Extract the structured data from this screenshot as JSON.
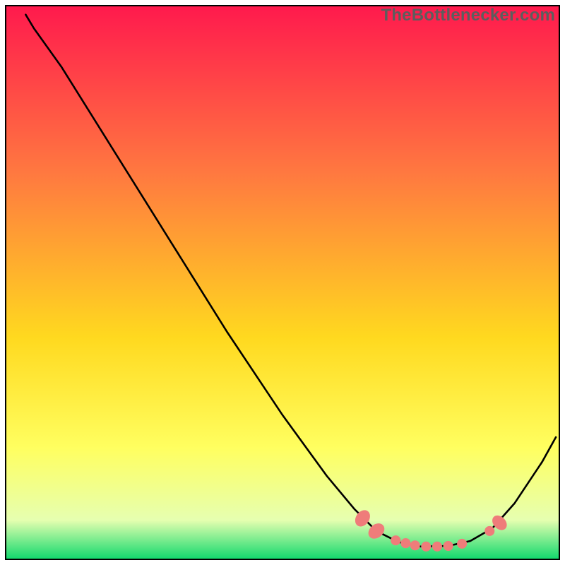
{
  "watermark": "TheBottlenecker.com",
  "colors": {
    "top": "#ff1a4d",
    "mid1": "#ff7840",
    "mid2": "#ffd91f",
    "mid3": "#ffff60",
    "mid4": "#e6ffb0",
    "bottom": "#14d96e",
    "curve": "#000000",
    "marker": "#ef7c7a",
    "frame": "#000000"
  },
  "chart_data": {
    "type": "line",
    "title": "",
    "xlabel": "",
    "ylabel": "",
    "xlim": [
      0,
      100
    ],
    "ylim": [
      0,
      100
    ],
    "curve": [
      {
        "x": 3.5,
        "y": 98.5
      },
      {
        "x": 5.0,
        "y": 96.0
      },
      {
        "x": 10.0,
        "y": 89.0
      },
      {
        "x": 20.0,
        "y": 73.0
      },
      {
        "x": 30.0,
        "y": 57.0
      },
      {
        "x": 40.0,
        "y": 41.0
      },
      {
        "x": 50.0,
        "y": 26.0
      },
      {
        "x": 58.0,
        "y": 15.0
      },
      {
        "x": 63.0,
        "y": 9.0
      },
      {
        "x": 67.0,
        "y": 5.0
      },
      {
        "x": 71.0,
        "y": 3.0
      },
      {
        "x": 75.0,
        "y": 2.2
      },
      {
        "x": 80.0,
        "y": 2.3
      },
      {
        "x": 84.0,
        "y": 3.2
      },
      {
        "x": 88.0,
        "y": 5.5
      },
      {
        "x": 92.0,
        "y": 10.0
      },
      {
        "x": 97.0,
        "y": 17.5
      },
      {
        "x": 99.5,
        "y": 22.0
      }
    ],
    "markers": [
      {
        "x": 64.5,
        "y": 7.3,
        "shape": "oval",
        "rx": 1.6,
        "ry": 1.2,
        "rot": -55
      },
      {
        "x": 67.0,
        "y": 5.0,
        "shape": "oval",
        "rx": 1.6,
        "ry": 1.2,
        "rot": -40
      },
      {
        "x": 70.5,
        "y": 3.3,
        "shape": "dot",
        "r": 0.9
      },
      {
        "x": 72.3,
        "y": 2.8,
        "shape": "dot",
        "r": 0.9
      },
      {
        "x": 74.0,
        "y": 2.4,
        "shape": "dot",
        "r": 0.9
      },
      {
        "x": 76.0,
        "y": 2.2,
        "shape": "dot",
        "r": 0.9
      },
      {
        "x": 78.0,
        "y": 2.2,
        "shape": "dot",
        "r": 0.9
      },
      {
        "x": 80.0,
        "y": 2.3,
        "shape": "dot",
        "r": 0.9
      },
      {
        "x": 82.5,
        "y": 2.7,
        "shape": "dot",
        "r": 0.9
      },
      {
        "x": 87.5,
        "y": 5.0,
        "shape": "dot",
        "r": 0.9
      },
      {
        "x": 89.3,
        "y": 6.5,
        "shape": "oval",
        "rx": 1.5,
        "ry": 1.1,
        "rot": 45
      }
    ]
  }
}
